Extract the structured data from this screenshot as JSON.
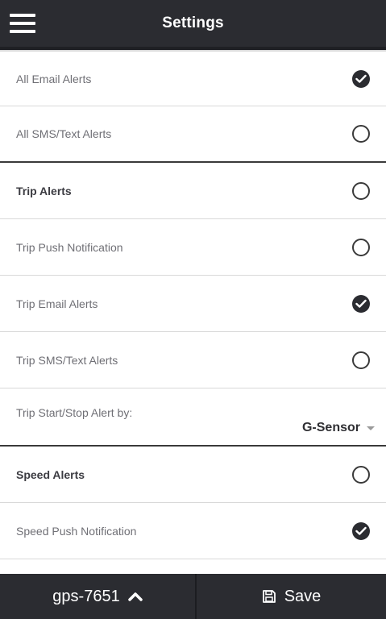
{
  "header": {
    "title": "Settings"
  },
  "settings": {
    "all_email": {
      "label": "All Email Alerts",
      "checked": true
    },
    "all_sms": {
      "label": "All SMS/Text Alerts",
      "checked": false
    },
    "trip_alerts": {
      "label": "Trip Alerts",
      "checked": false
    },
    "trip_push": {
      "label": "Trip Push Notification",
      "checked": false
    },
    "trip_email": {
      "label": "Trip Email Alerts",
      "checked": true
    },
    "trip_sms": {
      "label": "Trip SMS/Text Alerts",
      "checked": false
    },
    "trip_start_stop": {
      "label": "Trip Start/Stop Alert by:",
      "value": "G-Sensor"
    },
    "speed_alerts": {
      "label": "Speed Alerts",
      "checked": false
    },
    "speed_push": {
      "label": "Speed Push Notification",
      "checked": true
    }
  },
  "footer": {
    "device": "gps-7651",
    "save_label": "Save"
  },
  "colors": {
    "header_bg": "#2b2c31",
    "text_muted": "#6f6f75"
  }
}
